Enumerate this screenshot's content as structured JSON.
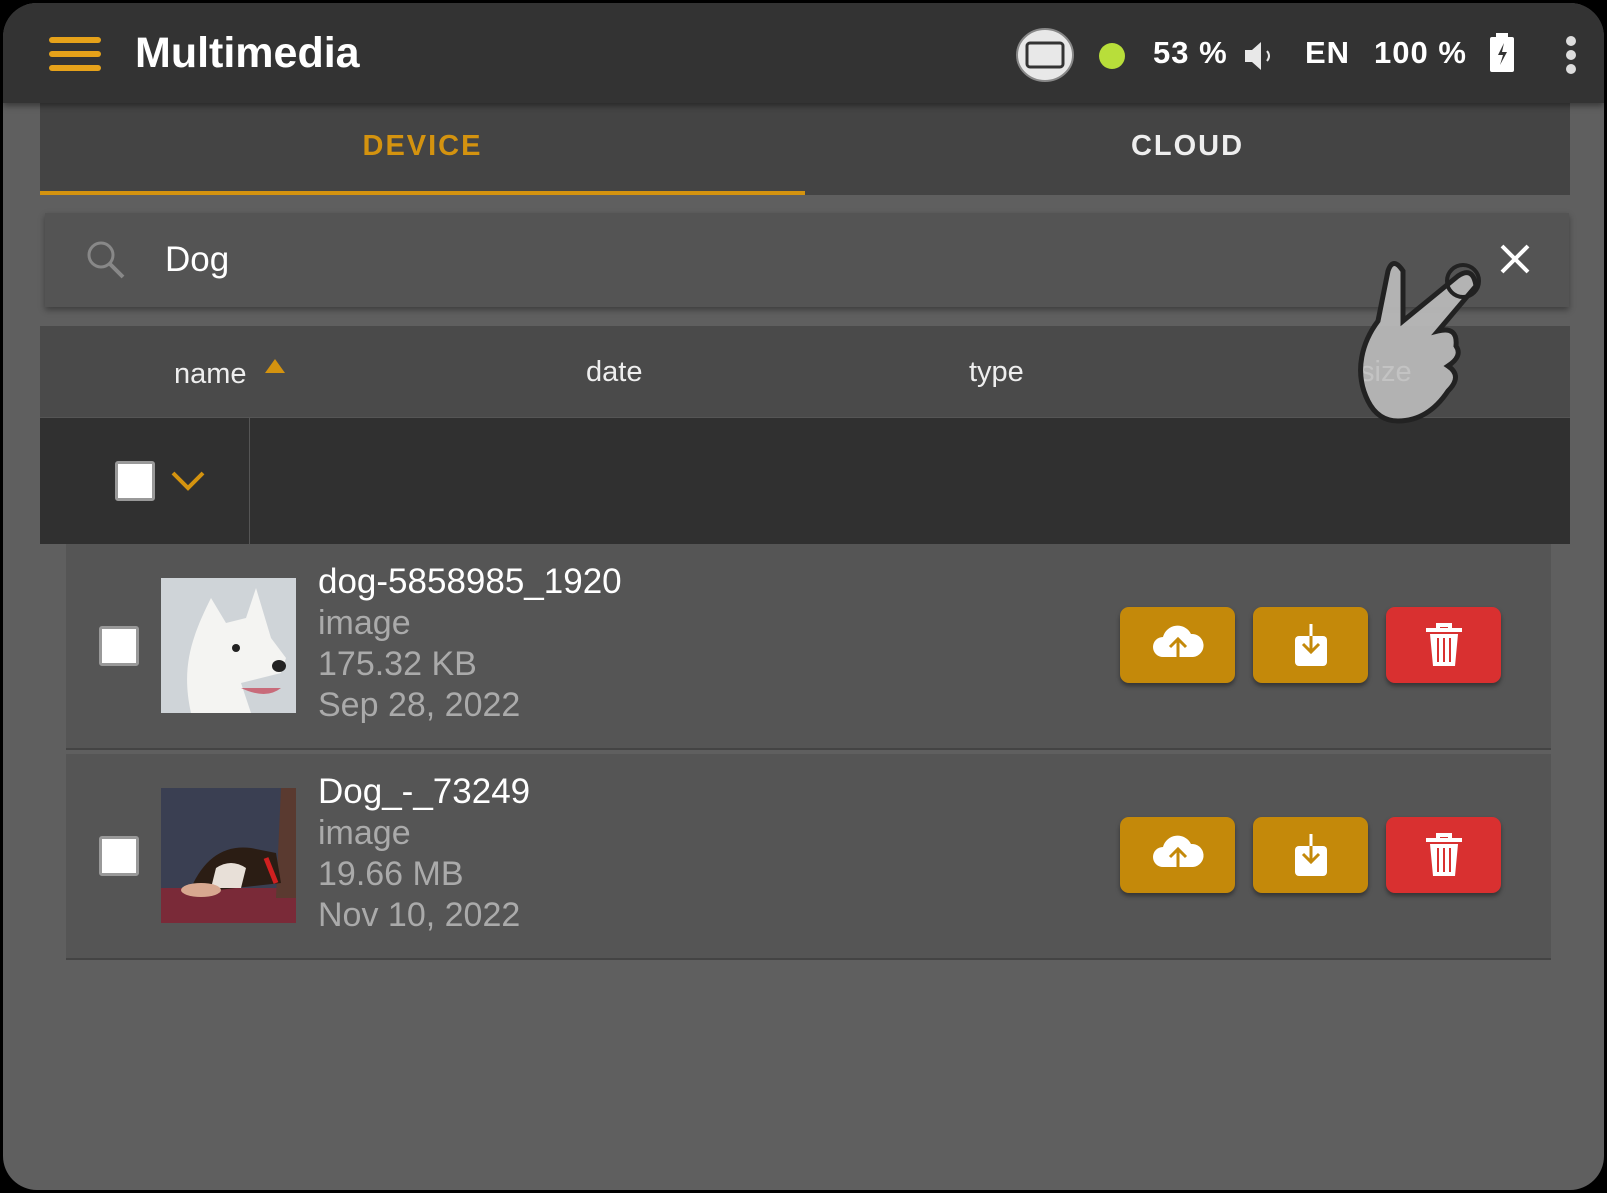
{
  "app": {
    "title": "Multimedia"
  },
  "status": {
    "wifi_signal": "53 %",
    "language": "EN",
    "battery": "100 %",
    "wifi_color": "#b8de3a"
  },
  "tabs": [
    {
      "label": "DEVICE",
      "active": true
    },
    {
      "label": "CLOUD",
      "active": false
    }
  ],
  "search": {
    "value": "Dog"
  },
  "columns": {
    "name": "name",
    "date": "date",
    "type": "type",
    "size": "size",
    "sort": "name ascending"
  },
  "colors": {
    "accent": "#d4930f",
    "upload": "#c4890a",
    "delete": "#d93030"
  },
  "items": [
    {
      "name": "dog-5858985_1920",
      "type": "image",
      "size": "175.32 KB",
      "date": "Sep 28, 2022",
      "thumb": "white dog"
    },
    {
      "name": "Dog_-_73249",
      "type": "image",
      "size": "19.66 MB",
      "date": "Nov 10, 2022",
      "thumb": "puppy"
    }
  ]
}
